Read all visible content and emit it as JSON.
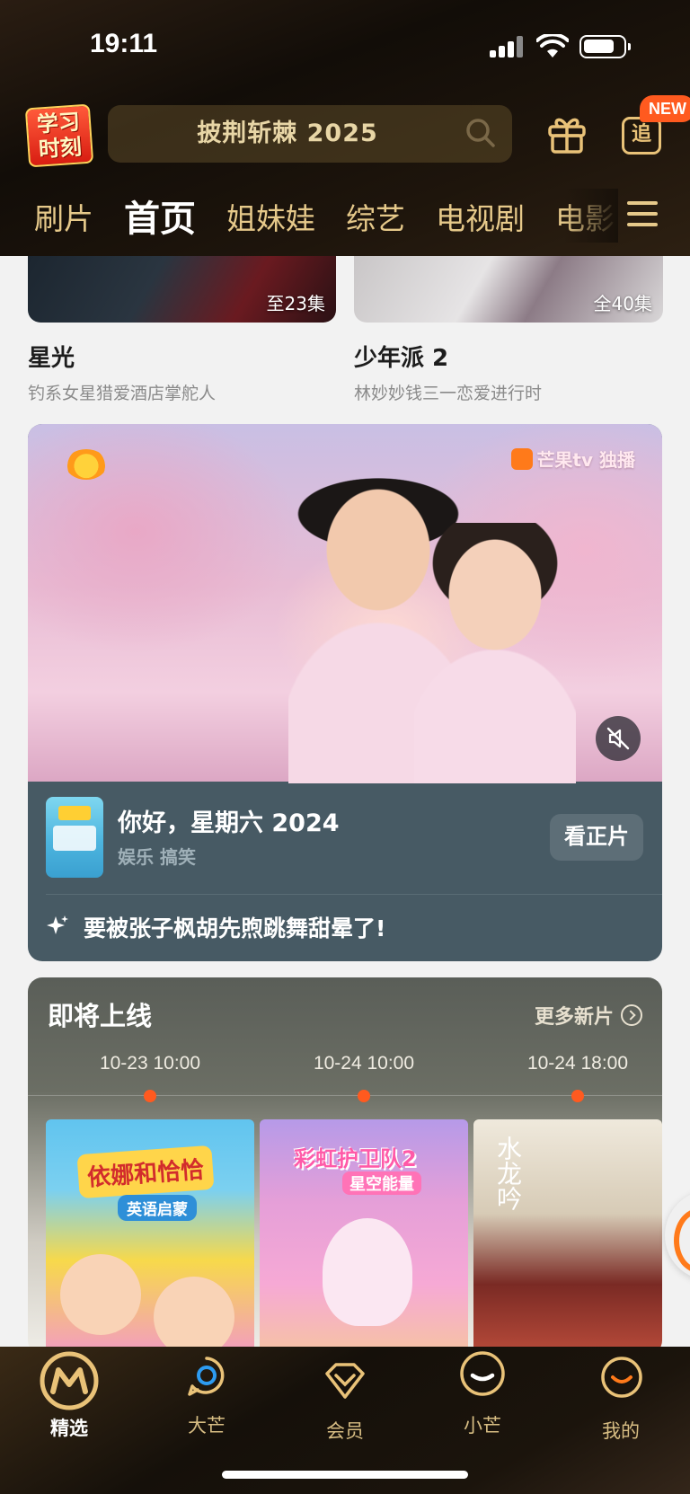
{
  "status_bar": {
    "time": "19:11"
  },
  "header": {
    "logo_text": [
      "学习",
      "时刻"
    ],
    "search_placeholder": "披荆斩棘 2025",
    "follow_label": "追",
    "new_badge": "NEW"
  },
  "nav_tabs": [
    {
      "label": "刷片",
      "active": false
    },
    {
      "label": "首页",
      "active": true
    },
    {
      "label": "姐妹娃",
      "active": false
    },
    {
      "label": "综艺",
      "active": false
    },
    {
      "label": "电视剧",
      "active": false
    },
    {
      "label": "电影",
      "active": false
    }
  ],
  "top_cards": [
    {
      "title": "星光",
      "subtitle": "钓系女星猎爱酒店掌舵人",
      "episodes": "至23集"
    },
    {
      "title": "少年派 2",
      "subtitle": "林妙妙钱三一恋爱进行时",
      "episodes": "全40集"
    }
  ],
  "featured": {
    "brand": "芒果tv 独播",
    "show_title": "你好，星期六 2024",
    "tags": "娱乐 搞笑",
    "watch_label": "看正片",
    "highlight": "要被张子枫胡先煦跳舞甜晕了!"
  },
  "upcoming": {
    "title": "即将上线",
    "more_label": "更多新片",
    "schedule": [
      {
        "time": "10-23 10:00",
        "poster_title": "依娜和恰恰",
        "poster_sub": "英语启蒙"
      },
      {
        "time": "10-24 10:00",
        "poster_title": "彩虹护卫队2",
        "poster_sub": "星空能量"
      },
      {
        "time": "10-24 18:00",
        "poster_title": "水龙吟",
        "poster_sub": ""
      }
    ]
  },
  "bottom_nav": [
    {
      "label": "精选",
      "icon": "mango-logo-icon",
      "active": true
    },
    {
      "label": "大芒",
      "icon": "dmang-icon",
      "active": false
    },
    {
      "label": "会员",
      "icon": "vip-diamond-icon",
      "active": false
    },
    {
      "label": "小芒",
      "icon": "xmang-icon",
      "active": false
    },
    {
      "label": "我的",
      "icon": "profile-icon",
      "active": false
    }
  ],
  "colors": {
    "header_gold": "#e6c98a",
    "accent_orange": "#ff5a1f",
    "feature_bg": "#475a64"
  }
}
